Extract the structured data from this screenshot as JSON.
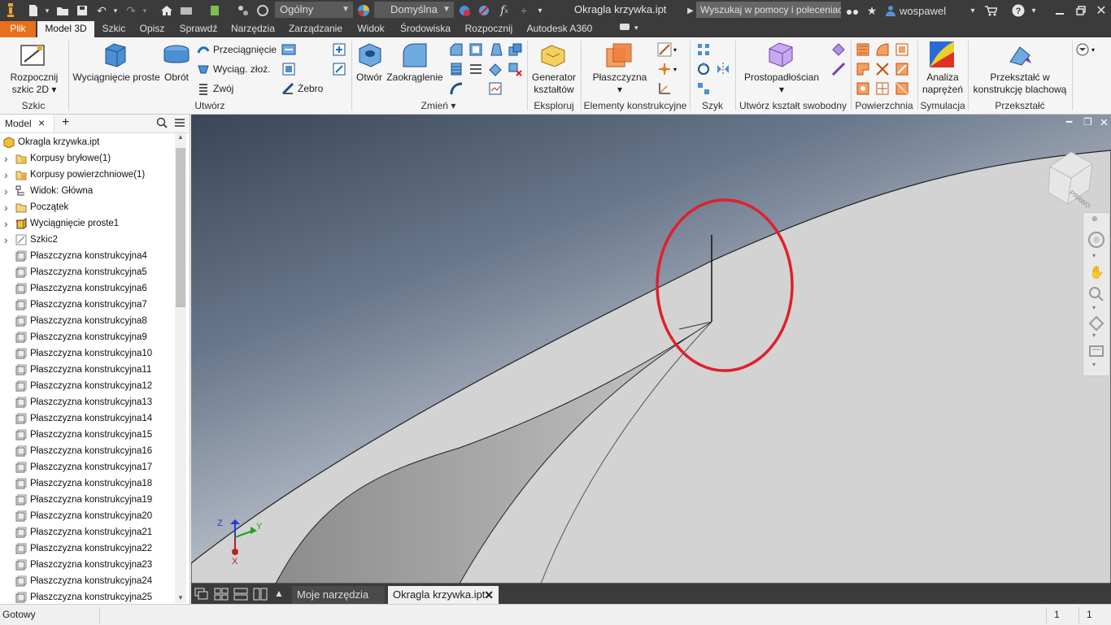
{
  "titlebar": {
    "material": "Ogólny",
    "appearance": "Domyślna",
    "doc_title": "Okragla krzywka.ipt",
    "search_placeholder": "Wyszukaj w pomocy i poleceniach",
    "user": "wospawel",
    "help": "?"
  },
  "tabs": [
    "Plik",
    "Model 3D",
    "Szkic",
    "Opisz",
    "Sprawdź",
    "Narzędzia",
    "Zarządzanie",
    "Widok",
    "Środowiska",
    "Rozpocznij",
    "Autodesk A360"
  ],
  "ribbon": {
    "start_sketch": "Rozpocznij szkic 2D",
    "extrude": "Wyciągnięcie proste",
    "revolve": "Obrót",
    "sweep": "Przeciągnięcie",
    "loft": "Wyciąg. złoż.",
    "coil": "Zwój",
    "rib": "Żebro",
    "hole": "Otwór",
    "fillet": "Zaokrąglenie",
    "shape_generator": "Generator kształtów",
    "plane": "Płaszczyzna",
    "box": "Prostopadłościan",
    "stress": "Analiza naprężeń",
    "convert_sheet": "Przekształć w konstrukcję blachową",
    "groups": {
      "sketch": "Szkic",
      "create": "Utwórz",
      "modify": "Zmień",
      "explore": "Eksploruj",
      "work_features": "Elementy konstrukcyjne",
      "pattern": "Szyk",
      "freeform": "Utwórz kształt swobodny",
      "surface": "Powierzchnia",
      "simulation": "Symulacja",
      "convert": "Przekształć"
    }
  },
  "browser": {
    "tab_label": "Model",
    "items": [
      {
        "label": "Okragla krzywka.ipt",
        "icon": "part-icon",
        "expand": ""
      },
      {
        "label": "Korpusy bryłowe(1)",
        "icon": "solid-bodies-icon",
        "expand": ">"
      },
      {
        "label": "Korpusy powierzchniowe(1)",
        "icon": "surface-bodies-icon",
        "expand": ">"
      },
      {
        "label": "Widok: Główna",
        "icon": "view-icon",
        "expand": ">"
      },
      {
        "label": "Początek",
        "icon": "origin-folder-icon",
        "expand": ">"
      },
      {
        "label": "Wyciągnięcie proste1",
        "icon": "extrude-feature-icon",
        "expand": ">"
      },
      {
        "label": "Szkic2",
        "icon": "sketch-icon",
        "expand": ">"
      },
      {
        "label": "Płaszczyzna konstrukcyjna4",
        "icon": "work-plane-icon",
        "expand": ""
      },
      {
        "label": "Płaszczyzna konstrukcyjna5",
        "icon": "work-plane-icon",
        "expand": ""
      },
      {
        "label": "Płaszczyzna konstrukcyjna6",
        "icon": "work-plane-icon",
        "expand": ""
      },
      {
        "label": "Płaszczyzna konstrukcyjna7",
        "icon": "work-plane-icon",
        "expand": ""
      },
      {
        "label": "Płaszczyzna konstrukcyjna8",
        "icon": "work-plane-icon",
        "expand": ""
      },
      {
        "label": "Płaszczyzna konstrukcyjna9",
        "icon": "work-plane-icon",
        "expand": ""
      },
      {
        "label": "Płaszczyzna konstrukcyjna10",
        "icon": "work-plane-icon",
        "expand": ""
      },
      {
        "label": "Płaszczyzna konstrukcyjna11",
        "icon": "work-plane-icon",
        "expand": ""
      },
      {
        "label": "Płaszczyzna konstrukcyjna12",
        "icon": "work-plane-icon",
        "expand": ""
      },
      {
        "label": "Płaszczyzna konstrukcyjna13",
        "icon": "work-plane-icon",
        "expand": ""
      },
      {
        "label": "Płaszczyzna konstrukcyjna14",
        "icon": "work-plane-icon",
        "expand": ""
      },
      {
        "label": "Płaszczyzna konstrukcyjna15",
        "icon": "work-plane-icon",
        "expand": ""
      },
      {
        "label": "Płaszczyzna konstrukcyjna16",
        "icon": "work-plane-icon",
        "expand": ""
      },
      {
        "label": "Płaszczyzna konstrukcyjna17",
        "icon": "work-plane-icon",
        "expand": ""
      },
      {
        "label": "Płaszczyzna konstrukcyjna18",
        "icon": "work-plane-icon",
        "expand": ""
      },
      {
        "label": "Płaszczyzna konstrukcyjna19",
        "icon": "work-plane-icon",
        "expand": ""
      },
      {
        "label": "Płaszczyzna konstrukcyjna20",
        "icon": "work-plane-icon",
        "expand": ""
      },
      {
        "label": "Płaszczyzna konstrukcyjna21",
        "icon": "work-plane-icon",
        "expand": ""
      },
      {
        "label": "Płaszczyzna konstrukcyjna22",
        "icon": "work-plane-icon",
        "expand": ""
      },
      {
        "label": "Płaszczyzna konstrukcyjna23",
        "icon": "work-plane-icon",
        "expand": ""
      },
      {
        "label": "Płaszczyzna konstrukcyjna24",
        "icon": "work-plane-icon",
        "expand": ""
      },
      {
        "label": "Płaszczyzna konstrukcyjna25",
        "icon": "work-plane-icon",
        "expand": ""
      }
    ]
  },
  "viewcube_label": "PRAWO",
  "axes": {
    "x": "X",
    "y": "Y",
    "z": "Z"
  },
  "doctabs": {
    "tab1": "Moje narzędzia g...",
    "tab2": "Okragla krzywka.ipt"
  },
  "status": {
    "text": "Gotowy",
    "count1": "1",
    "count2": "1"
  },
  "colors": {
    "accent": "#e8701a",
    "highlight_circle": "#e0202a",
    "dark_chrome": "#3b3b3b"
  }
}
